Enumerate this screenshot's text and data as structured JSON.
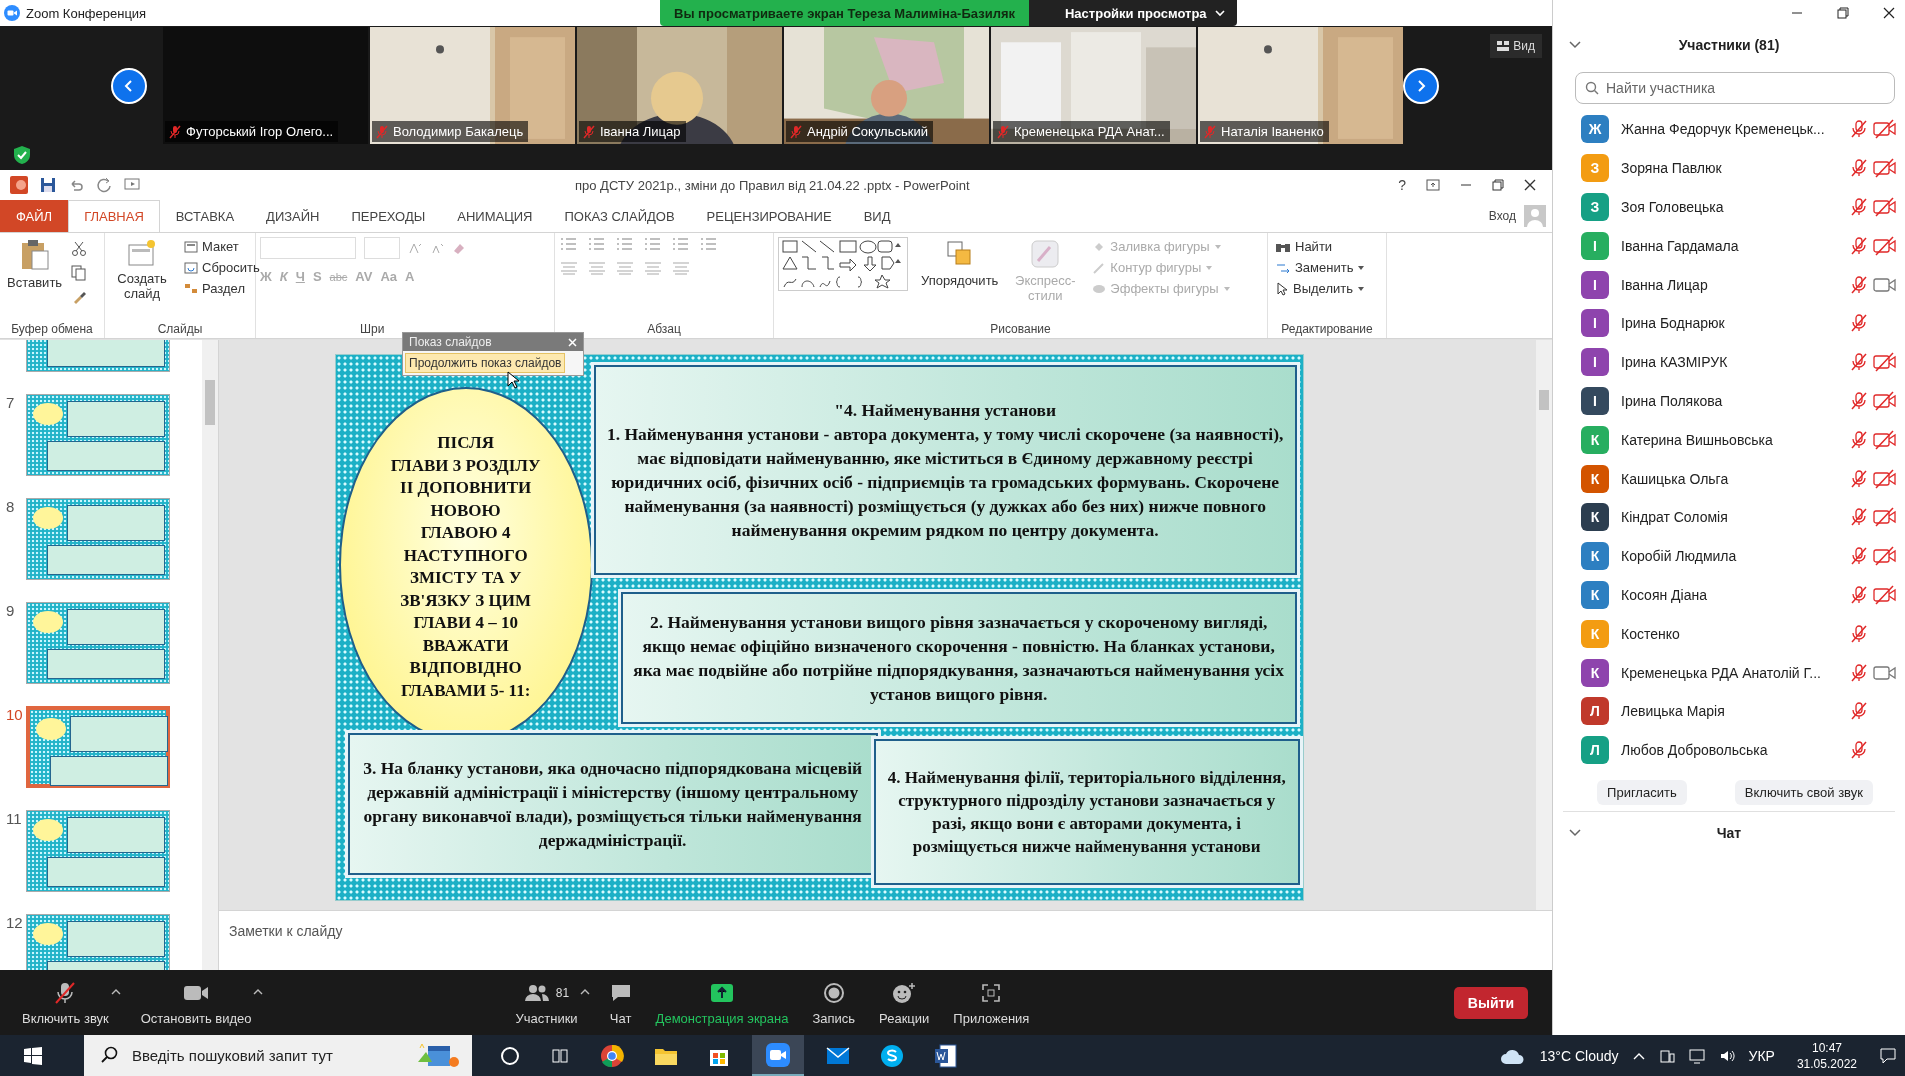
{
  "window": {
    "title": "Zoom Конференция"
  },
  "share_banner": {
    "text": "Вы просматриваете экран Тереза Малиміна-Базиляк",
    "settings": "Настройки просмотра"
  },
  "video_strip": {
    "view_button": "Вид",
    "tiles": [
      {
        "name": "Футорський Ігор Олего...",
        "muted": true,
        "kind": "dark"
      },
      {
        "name": "Володимир Бакалець",
        "muted": true,
        "kind": "room"
      },
      {
        "name": "Іванна Лицар",
        "muted": true,
        "kind": "person"
      },
      {
        "name": "Андрій Сокульський",
        "muted": true,
        "kind": "map"
      },
      {
        "name": "Кременецька РДА Анат...",
        "muted": true,
        "kind": "window"
      },
      {
        "name": "Наталія Іваненко",
        "muted": true,
        "kind": "room"
      }
    ]
  },
  "powerpoint": {
    "title": "про ДСТУ 2021р., зміни до Правил  від 21.04.22 .pptx - PowerPoint",
    "help": "?",
    "sign_in": "Вход",
    "tabs": [
      {
        "label": "ФАЙЛ",
        "kind": "file",
        "selected": false
      },
      {
        "label": "ГЛАВНАЯ",
        "kind": "tab",
        "selected": true
      },
      {
        "label": "ВСТАВКА",
        "kind": "tab",
        "selected": false
      },
      {
        "label": "ДИЗАЙН",
        "kind": "tab",
        "selected": false
      },
      {
        "label": "ПЕРЕХОДЫ",
        "kind": "tab",
        "selected": false
      },
      {
        "label": "АНИМАЦИЯ",
        "kind": "tab",
        "selected": false
      },
      {
        "label": "ПОКАЗ СЛАЙДОВ",
        "kind": "tab",
        "selected": false
      },
      {
        "label": "РЕЦЕНЗИРОВАНИЕ",
        "kind": "tab",
        "selected": false
      },
      {
        "label": "ВИД",
        "kind": "tab",
        "selected": false
      }
    ],
    "ribbon": {
      "clipboard": {
        "label": "Буфер обмена",
        "paste": "Вставить"
      },
      "slides": {
        "label": "Слайды",
        "new_slide": "Создать слайд",
        "layout": "Макет",
        "reset": "Сбросить",
        "section": "Раздел"
      },
      "font": {
        "label": "Шри",
        "disabled": true,
        "buttons": [
          "Ж",
          "К",
          "Ч",
          "S",
          "abc",
          "AV",
          "Aa",
          "A"
        ]
      },
      "paragraph": {
        "label": "Абзац",
        "disabled": true
      },
      "drawing": {
        "label": "Рисование",
        "arrange": {
          "label": "Упорядочить",
          "disabled": false
        },
        "quick_styles": {
          "label": "Экспресс-стили",
          "disabled": true
        },
        "fill": {
          "label": "Заливка фигуры",
          "disabled": true
        },
        "outline": {
          "label": "Контур фигуры",
          "disabled": true
        },
        "effects": {
          "label": "Эффекты фигуры",
          "disabled": true
        }
      },
      "editing": {
        "label": "Редактирование",
        "find": "Найти",
        "replace": "Заменить",
        "select": "Выделить"
      }
    },
    "popup": {
      "title": "Показ слайдов",
      "item": "Продолжить показ слайдов"
    },
    "thumbnails": [
      {
        "selected": false
      },
      {
        "number": "7",
        "selected": false
      },
      {
        "number": "8",
        "selected": false
      },
      {
        "number": "9",
        "selected": false
      },
      {
        "number": "10",
        "selected": true
      },
      {
        "number": "11",
        "selected": false
      },
      {
        "number": "12",
        "selected": false
      }
    ],
    "slide": {
      "ellipse": "ПІСЛЯ\nГЛАВИ 3 РОЗДІЛУ\nII ДОПОВНИТИ\nНОВОЮ\nГЛАВОЮ 4\nНАСТУПНОГО\nЗМІСТУ ТА У\nЗВ'ЯЗКУ З ЦИМ\nГЛАВИ  4 – 10\nВВАЖАТИ\nВІДПОВІДНО\nГЛАВАМИ 5- 11:",
      "box_1_title": "\"4. Найменування установи",
      "box_1": "1. Найменування установи - автора документа, у тому числі скорочене (за наявності), має відповідати найменуванню, яке міститься в Єдиному державному реєстрі юридичних осіб, фізичних осіб - підприємців та громадських формувань. Скорочене найменування (за наявності) розміщується (у дужках або без них) нижче повного найменування окремим рядком по центру документа.",
      "box_2": "2. Найменування установи вищого рівня зазначається у скороченому вигляді, якщо немає офіційно визначеного скорочення - повністю. На бланках установи, яка має подвійне або потрійне підпорядкування, зазначаються найменування усіх установ вищого рівня.",
      "box_3": "3. На бланку установи, яка одночасно підпорядкована місцевій державній адміністрації і міністерству (іншому центральному органу виконавчої влади), розміщується тільки найменування держадміністрації.",
      "box_4": "4. Найменування філії, територіального відділення, структурного підрозділу установи зазначається у разі, якщо вони є авторами документа, і розміщується нижче найменування установи"
    },
    "notes_placeholder": "Заметки к слайду"
  },
  "toolbar": {
    "items": [
      {
        "label": "Включить звук",
        "kind": "mic_muted"
      },
      {
        "label": "Остановить видео",
        "kind": "video"
      },
      {
        "label": "Участники",
        "kind": "participants",
        "count": "81"
      },
      {
        "label": "Чат",
        "kind": "chat"
      },
      {
        "label": "Демонстрация экрана",
        "kind": "share"
      },
      {
        "label": "Запись",
        "kind": "record"
      },
      {
        "label": "Реакции",
        "kind": "reactions"
      },
      {
        "label": "Приложения",
        "kind": "apps"
      }
    ],
    "leave": "Выйти"
  },
  "participants_panel": {
    "title": "Участники (81)",
    "search_placeholder": "Найти участника",
    "participants": [
      {
        "initial": "Ж",
        "name": "Жанна Федорчук Кременецьк...",
        "color": "#2d7fc1",
        "muted": true,
        "camera_on": false
      },
      {
        "initial": "З",
        "name": "Зоряна Павлюк",
        "color": "#f39c12",
        "muted": true,
        "camera_on": false
      },
      {
        "initial": "З",
        "name": "Зоя Головецька",
        "color": "#16a085",
        "muted": true,
        "camera_on": false
      },
      {
        "initial": "І",
        "name": "Іванна Гардамала",
        "color": "#27ae60",
        "muted": true,
        "camera_on": false
      },
      {
        "initial": "І",
        "name": "Іванна Лицар",
        "color": "#8e44ad",
        "muted": true,
        "camera_on": true
      },
      {
        "initial": "І",
        "name": "Ірина Боднарюк",
        "color": "#8e44ad",
        "muted": true
      },
      {
        "initial": "І",
        "name": "Ірина КАЗМІРУК",
        "color": "#8e44ad",
        "muted": true,
        "camera_on": false
      },
      {
        "initial": "І",
        "name": "Ірина Полякова",
        "color": "#34495e",
        "muted": true,
        "camera_on": false
      },
      {
        "initial": "К",
        "name": "Катерина Вишньовська",
        "color": "#27ae60",
        "muted": true,
        "camera_on": false
      },
      {
        "initial": "К",
        "name": "Кашицька Ольга",
        "color": "#d35400",
        "muted": true,
        "camera_on": false
      },
      {
        "initial": "К",
        "name": "Кіндрат Соломія",
        "color": "#2c3e50",
        "muted": true,
        "camera_on": false
      },
      {
        "initial": "К",
        "name": "Коробій Людмила",
        "color": "#2d7fc1",
        "muted": true,
        "camera_on": false
      },
      {
        "initial": "К",
        "name": "Косоян Діана",
        "color": "#2d7fc1",
        "muted": true,
        "camera_on": false
      },
      {
        "initial": "К",
        "name": "Костенко",
        "color": "#f39c12",
        "muted": true
      },
      {
        "initial": "К",
        "name": "Кременецька РДА Анатолій Г...",
        "color": "#8e44ad",
        "muted": true,
        "camera_on": true
      },
      {
        "initial": "Л",
        "name": "Левицька Марія",
        "color": "#c0392b",
        "muted": true
      },
      {
        "initial": "Л",
        "name": "Любов Добровольська",
        "color": "#16a085",
        "muted": true
      }
    ],
    "buttons": [
      "Пригласить",
      "Включить свой звук"
    ],
    "chat_title": "Чат"
  },
  "taskbar": {
    "search_placeholder": "Введіть пошуковий запит тут",
    "weather": "13°C Cloudy",
    "language": "УКР",
    "time": "10:47",
    "date": "31.05.2022"
  }
}
